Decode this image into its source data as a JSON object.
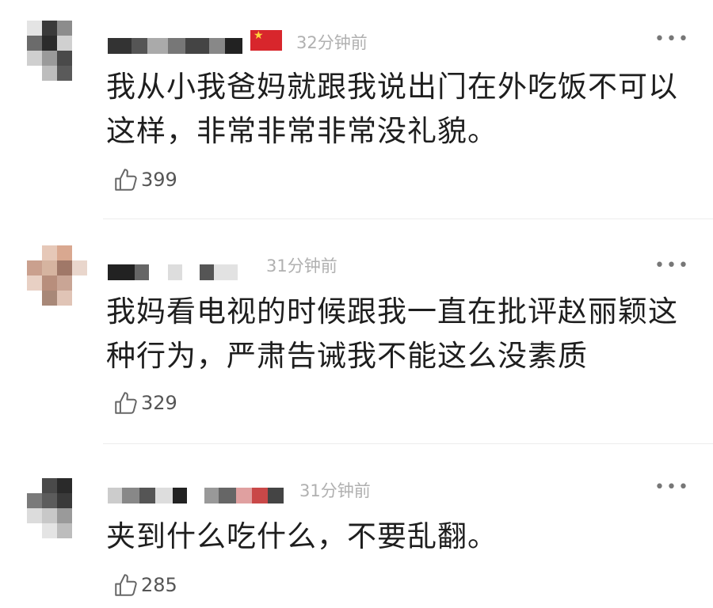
{
  "comments": [
    {
      "time": "32分钟前",
      "text": "我从小我爸妈就跟我说出门在外吃饭不可以这样，非常非常非常没礼貌。",
      "likes": "399",
      "has_flag": true
    },
    {
      "time": "31分钟前",
      "text": "我妈看电视的时候跟我一直在批评赵丽颖这种行为，严肃告诫我不能这么没素质",
      "likes": "329",
      "has_flag": false
    },
    {
      "time": "31分钟前",
      "text": "夹到什么吃什么，不要乱翻。",
      "likes": "285",
      "has_flag": false
    }
  ],
  "more_label": "•••",
  "icons": {
    "like": "thumbs-up-icon",
    "more": "more-dots-icon",
    "flag": "china-flag-icon"
  }
}
